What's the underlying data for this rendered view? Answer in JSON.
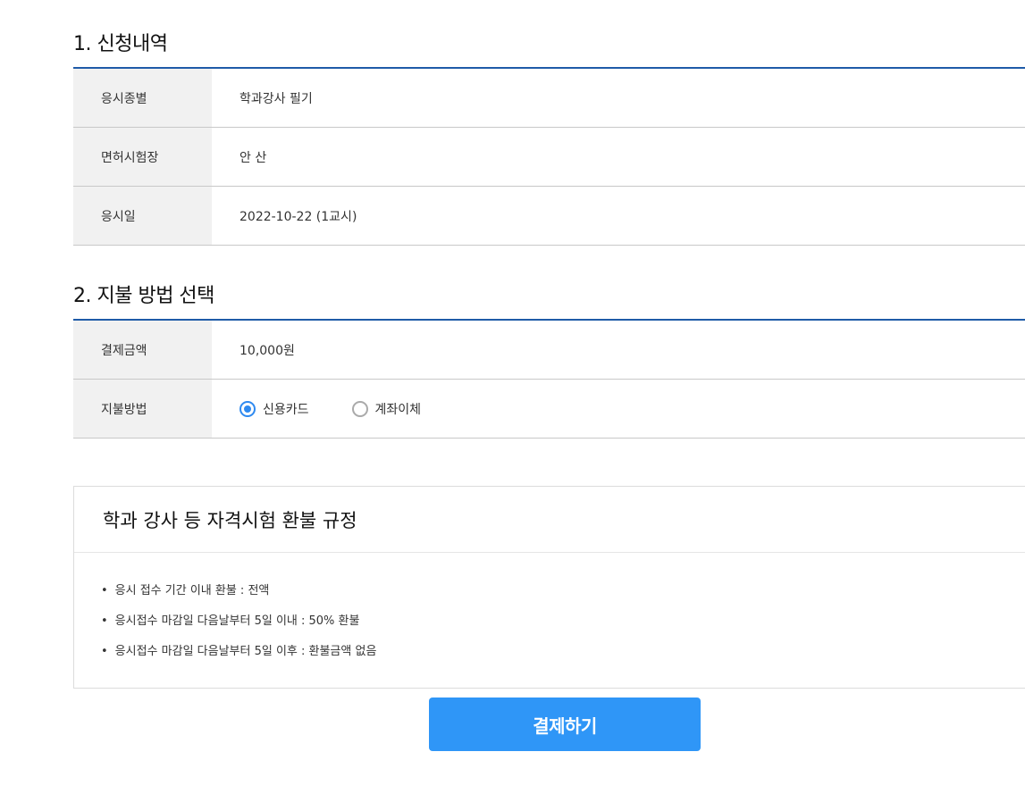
{
  "section1": {
    "title": "1. 신청내역",
    "rows": [
      {
        "label": "응시종별",
        "value": "학과강사 필기"
      },
      {
        "label": "면허시험장",
        "value": "안 산"
      },
      {
        "label": "응시일",
        "value": "2022-10-22 (1교시)"
      }
    ]
  },
  "section2": {
    "title": "2. 지불 방법 선택",
    "amount": {
      "label": "결제금액",
      "value": "10,000원"
    },
    "method": {
      "label": "지불방법",
      "options": [
        {
          "label": "신용카드",
          "selected": true
        },
        {
          "label": "계좌이체",
          "selected": false
        }
      ]
    }
  },
  "refund": {
    "title": "학과 강사 등 자격시험 환불 규정",
    "items": [
      "응시 접수 기간 이내 환불 : 전액",
      "응시접수 마감일 다음날부터 5일 이내 : 50% 환불",
      "응시접수 마감일 다음날부터 5일 이후 : 환불금액 없음"
    ]
  },
  "pay_button": "결제하기",
  "colors": {
    "accent": "#2f96f7",
    "table_border": "#1f5ba8",
    "label_bg": "#f1f1f1"
  }
}
